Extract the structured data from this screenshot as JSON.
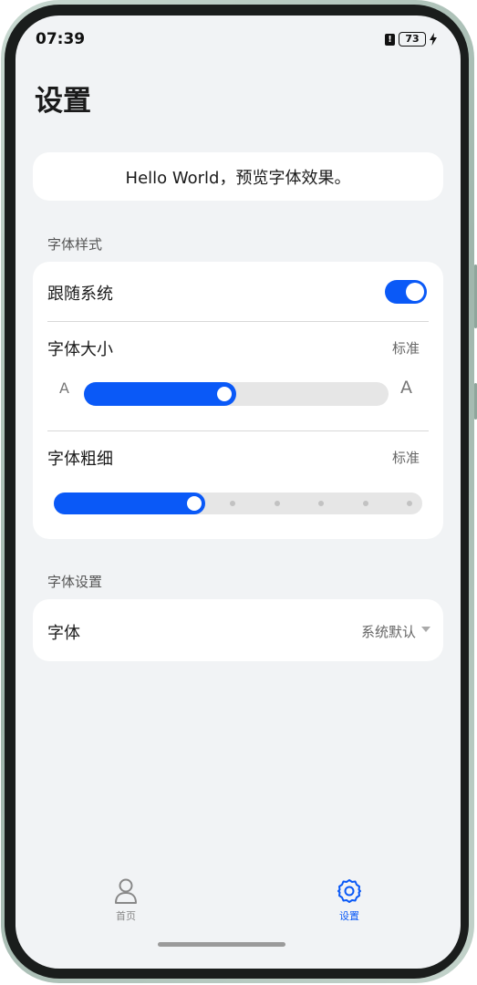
{
  "status_bar": {
    "time": "07:39",
    "alert_glyph": "!",
    "battery_level": "73",
    "charging_icon": "bolt-icon"
  },
  "page": {
    "title": "设置"
  },
  "preview": {
    "text": "Hello World，预览字体效果。"
  },
  "font_style_section": {
    "header": "字体样式",
    "follow_system": {
      "label": "跟随系统",
      "enabled": true
    },
    "font_size": {
      "label": "字体大小",
      "value": "标准",
      "small_glyph": "A",
      "large_glyph": "A",
      "level_fraction": 0.5
    },
    "font_weight": {
      "label": "字体粗细",
      "value": "标准",
      "level_fraction": 0.4,
      "steps": 8
    }
  },
  "font_settings_section": {
    "header": "字体设置",
    "font": {
      "label": "字体",
      "value": "系统默认"
    }
  },
  "tabbar": {
    "tabs": [
      {
        "label": "首页",
        "icon": "person-icon",
        "active": false
      },
      {
        "label": "设置",
        "icon": "gear-icon",
        "active": true
      }
    ]
  },
  "colors": {
    "accent": "#0a59f7",
    "background": "#f1f3f5",
    "card": "#ffffff",
    "inactive_tab": "#888888"
  }
}
